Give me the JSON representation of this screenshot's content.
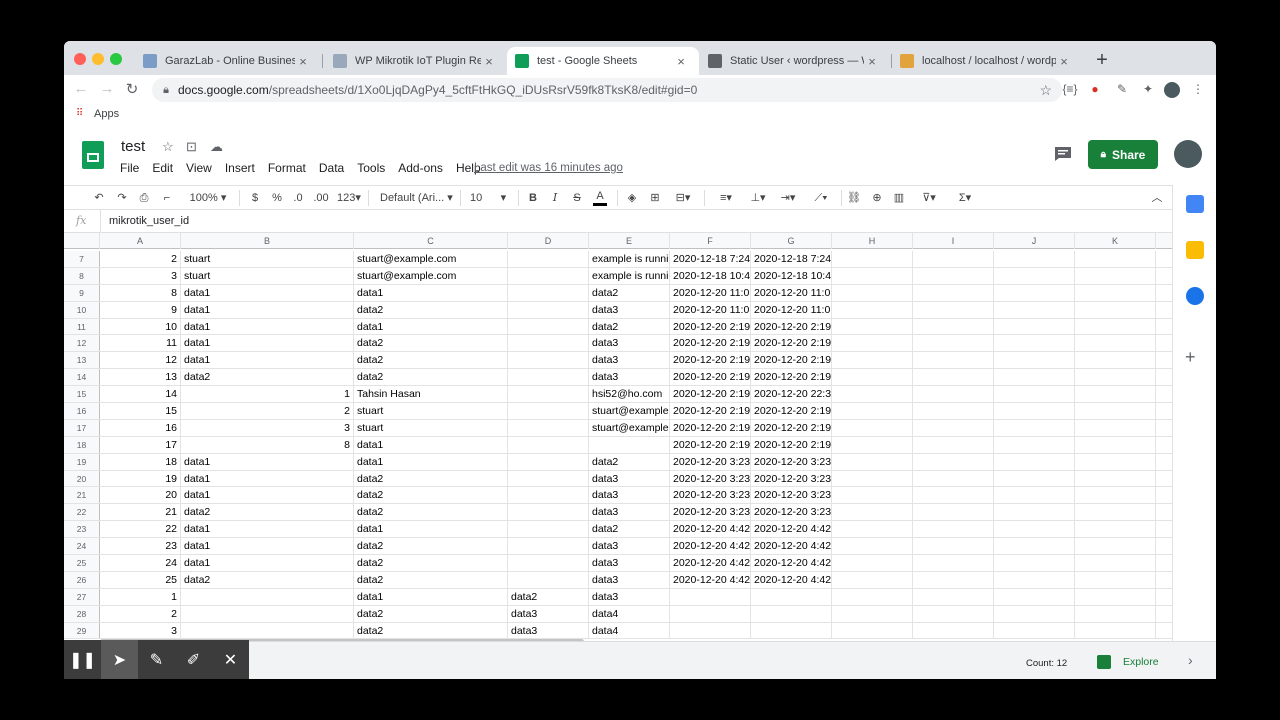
{
  "browser": {
    "tabs": [
      {
        "title": "GarazLab - Online Business M",
        "favicon_color": "#7a9cc6"
      },
      {
        "title": "WP Mikrotik IoT Plugin Realtim",
        "favicon_color": "#9aa8bc"
      },
      {
        "title": "test - Google Sheets",
        "favicon_color": "#0f9d58"
      },
      {
        "title": "Static User ‹ wordpress — Wo",
        "favicon_color": "#5f6368"
      },
      {
        "title": "localhost / localhost / wordpre",
        "favicon_color": "#e2a23c"
      }
    ],
    "new_tab_label": "+",
    "address_host": "docs.google.com",
    "address_path": "/spreadsheets/d/1Xo0LjqDAgPy4_5cftFtHkGQ_iDUsRsrV59fk8TksK8/edit#gid=0",
    "bookmarks": {
      "apps_label": "Apps"
    }
  },
  "sheets": {
    "doc_title": "test",
    "menu": [
      "File",
      "Edit",
      "View",
      "Insert",
      "Format",
      "Data",
      "Tools",
      "Add-ons",
      "Help"
    ],
    "last_edit": "Last edit was 16 minutes ago",
    "share_label": "Share",
    "toolbar": {
      "zoom": "100%",
      "currency": "$",
      "percent": "%",
      "dec_decrease": ".0",
      "dec_increase": ".00",
      "more_formats": "123",
      "font": "Default (Ari...",
      "font_size": "10",
      "bold": "B",
      "italic": "I",
      "strike": "S",
      "text_color": "A"
    },
    "formula_bar": {
      "icon": "fx",
      "value": "mikrotik_user_id"
    },
    "columns": [
      "A",
      "B",
      "C",
      "D",
      "E",
      "F",
      "G",
      "H",
      "I",
      "J",
      "K"
    ],
    "rows": [
      {
        "n": "7",
        "cells": [
          "2",
          "stuart",
          "stuart@example.com",
          "",
          "example is runni",
          "2020-12-18 7:24",
          "2020-12-18 7:24"
        ]
      },
      {
        "n": "8",
        "cells": [
          "3",
          "stuart",
          "stuart@example.com",
          "",
          "example is runni",
          "2020-12-18 10:4",
          "2020-12-18 10:4"
        ]
      },
      {
        "n": "9",
        "cells": [
          "8",
          "data1",
          "data1",
          "",
          "data2",
          "2020-12-20 11:0",
          "2020-12-20 11:0"
        ]
      },
      {
        "n": "10",
        "cells": [
          "9",
          "data1",
          "data2",
          "",
          "data3",
          "2020-12-20 11:0",
          "2020-12-20 11:0"
        ]
      },
      {
        "n": "11",
        "cells": [
          "10",
          "data1",
          "data1",
          "",
          "data2",
          "2020-12-20 2:19",
          "2020-12-20 2:19"
        ]
      },
      {
        "n": "12",
        "cells": [
          "11",
          "data1",
          "data2",
          "",
          "data3",
          "2020-12-20 2:19",
          "2020-12-20 2:19"
        ]
      },
      {
        "n": "13",
        "cells": [
          "12",
          "data1",
          "data2",
          "",
          "data3",
          "2020-12-20 2:19",
          "2020-12-20 2:19"
        ]
      },
      {
        "n": "14",
        "cells": [
          "13",
          "data2",
          "data2",
          "",
          "data3",
          "2020-12-20 2:19",
          "2020-12-20 2:19"
        ]
      },
      {
        "n": "15",
        "cells": [
          "14",
          "1",
          "Tahsin Hasan",
          "",
          "hsi52@ho.com",
          "2020-12-20 2:19",
          "2020-12-20 22:3"
        ]
      },
      {
        "n": "16",
        "cells": [
          "15",
          "2",
          "stuart",
          "",
          "stuart@example",
          "2020-12-20 2:19",
          "2020-12-20 2:19"
        ]
      },
      {
        "n": "17",
        "cells": [
          "16",
          "3",
          "stuart",
          "",
          "stuart@example",
          "2020-12-20 2:19",
          "2020-12-20 2:19"
        ]
      },
      {
        "n": "18",
        "cells": [
          "17",
          "8",
          "data1",
          "",
          "",
          "2020-12-20 2:19",
          "2020-12-20 2:19"
        ]
      },
      {
        "n": "19",
        "cells": [
          "18",
          "data1",
          "data1",
          "",
          "data2",
          "2020-12-20 3:23",
          "2020-12-20 3:23"
        ]
      },
      {
        "n": "20",
        "cells": [
          "19",
          "data1",
          "data2",
          "",
          "data3",
          "2020-12-20 3:23",
          "2020-12-20 3:23"
        ]
      },
      {
        "n": "21",
        "cells": [
          "20",
          "data1",
          "data2",
          "",
          "data3",
          "2020-12-20 3:23",
          "2020-12-20 3:23"
        ]
      },
      {
        "n": "22",
        "cells": [
          "21",
          "data2",
          "data2",
          "",
          "data3",
          "2020-12-20 3:23",
          "2020-12-20 3:23"
        ]
      },
      {
        "n": "23",
        "cells": [
          "22",
          "data1",
          "data1",
          "",
          "data2",
          "2020-12-20 4:42",
          "2020-12-20 4:42"
        ]
      },
      {
        "n": "24",
        "cells": [
          "23",
          "data1",
          "data2",
          "",
          "data3",
          "2020-12-20 4:42",
          "2020-12-20 4:42"
        ]
      },
      {
        "n": "25",
        "cells": [
          "24",
          "data1",
          "data2",
          "",
          "data3",
          "2020-12-20 4:42",
          "2020-12-20 4:42"
        ]
      },
      {
        "n": "26",
        "cells": [
          "25",
          "data2",
          "data2",
          "",
          "data3",
          "2020-12-20 4:42",
          "2020-12-20 4:42"
        ]
      },
      {
        "n": "27",
        "cells": [
          "1",
          "",
          "data1",
          "data2",
          "data3",
          "",
          ""
        ]
      },
      {
        "n": "28",
        "cells": [
          "2",
          "",
          "data2",
          "data3",
          "data4",
          "",
          ""
        ]
      },
      {
        "n": "29",
        "cells": [
          "3",
          "",
          "data2",
          "data3",
          "data4",
          "",
          ""
        ]
      }
    ],
    "status": {
      "count": "Count: 12",
      "explore": "Explore"
    }
  },
  "colors": {
    "brand_green": "#188038",
    "sheets_green": "#0f9d58"
  }
}
